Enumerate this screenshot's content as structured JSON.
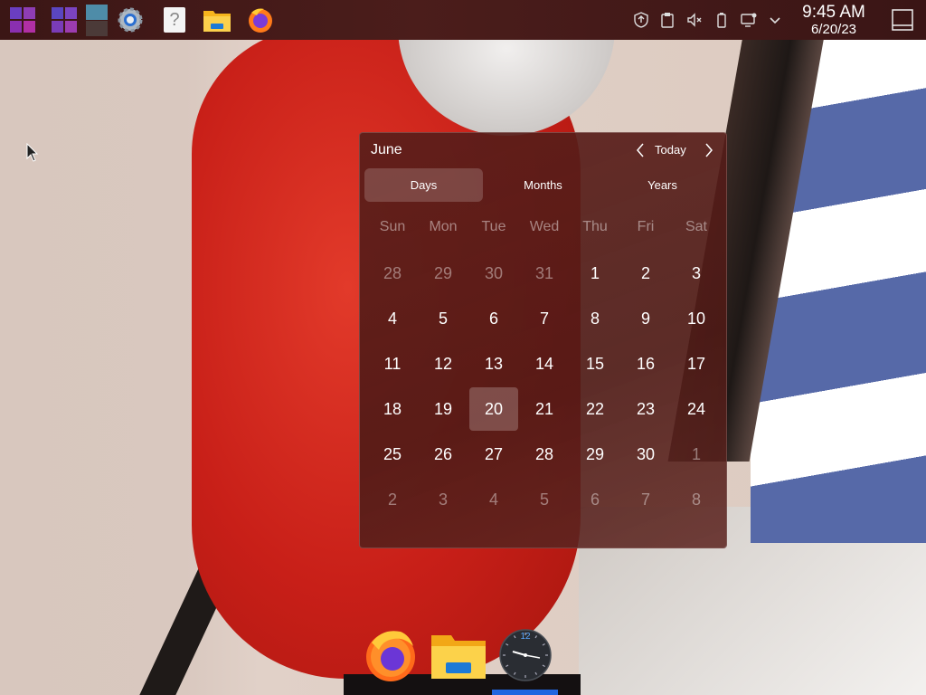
{
  "taskbar": {
    "launchers": [
      {
        "name": "application-launcher-icon"
      },
      {
        "name": "workspace-switcher-icon"
      },
      {
        "name": "virtual-desktops-icon"
      },
      {
        "name": "settings-icon"
      },
      {
        "name": "help-icon",
        "glyph": "?"
      },
      {
        "name": "file-manager-icon"
      },
      {
        "name": "firefox-icon"
      }
    ],
    "tray": [
      {
        "name": "update-icon"
      },
      {
        "name": "clipboard-icon"
      },
      {
        "name": "volume-muted-icon"
      },
      {
        "name": "battery-icon"
      },
      {
        "name": "display-icon"
      },
      {
        "name": "chevron-down-icon"
      }
    ],
    "clock": {
      "time": "9:45 AM",
      "date": "6/20/23"
    },
    "show_desktop_icon": "show-desktop-icon"
  },
  "calendar": {
    "month": "June",
    "today_label": "Today",
    "view_tabs": [
      "Days",
      "Months",
      "Years"
    ],
    "active_view": "Days",
    "weekdays": [
      "Sun",
      "Mon",
      "Tue",
      "Wed",
      "Thu",
      "Fri",
      "Sat"
    ],
    "weeks": [
      [
        {
          "d": "28",
          "o": true
        },
        {
          "d": "29",
          "o": true
        },
        {
          "d": "30",
          "o": true
        },
        {
          "d": "31",
          "o": true
        },
        {
          "d": "1"
        },
        {
          "d": "2"
        },
        {
          "d": "3"
        }
      ],
      [
        {
          "d": "4"
        },
        {
          "d": "5"
        },
        {
          "d": "6"
        },
        {
          "d": "7"
        },
        {
          "d": "8"
        },
        {
          "d": "9"
        },
        {
          "d": "10"
        }
      ],
      [
        {
          "d": "11"
        },
        {
          "d": "12"
        },
        {
          "d": "13"
        },
        {
          "d": "14"
        },
        {
          "d": "15"
        },
        {
          "d": "16"
        },
        {
          "d": "17"
        }
      ],
      [
        {
          "d": "18"
        },
        {
          "d": "19"
        },
        {
          "d": "20",
          "t": true
        },
        {
          "d": "21"
        },
        {
          "d": "22"
        },
        {
          "d": "23"
        },
        {
          "d": "24"
        }
      ],
      [
        {
          "d": "25"
        },
        {
          "d": "26"
        },
        {
          "d": "27"
        },
        {
          "d": "28"
        },
        {
          "d": "29"
        },
        {
          "d": "30"
        },
        {
          "d": "1",
          "o": true
        }
      ],
      [
        {
          "d": "2",
          "o": true
        },
        {
          "d": "3",
          "o": true
        },
        {
          "d": "4",
          "o": true
        },
        {
          "d": "5",
          "o": true
        },
        {
          "d": "6",
          "o": true
        },
        {
          "d": "7",
          "o": true
        },
        {
          "d": "8",
          "o": true
        }
      ]
    ]
  },
  "dock": {
    "apps": [
      {
        "name": "firefox-icon"
      },
      {
        "name": "files-icon"
      },
      {
        "name": "clock-icon",
        "label": "12"
      }
    ]
  },
  "colors": {
    "accent": "#2166e0",
    "panel": "#4b1d1b"
  }
}
